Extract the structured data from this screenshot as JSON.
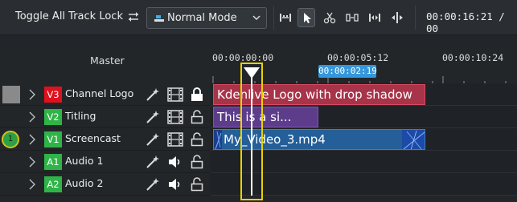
{
  "toolbar": {
    "toggle_lock_label": "Toggle All Track Lock",
    "mode_label": "Normal Mode",
    "timecode": "00:00:16:21 / 00",
    "tools": [
      "spacer-tool-icon",
      "selection-tool-icon",
      "razor-tool-icon",
      "slip-tool-icon",
      "ripple-tool-icon",
      "multicam-tool-icon"
    ]
  },
  "header": {
    "master_label": "Master"
  },
  "ruler": {
    "labels": [
      "00:00:00:00",
      "00:00:05:12",
      "00:00:10:24"
    ],
    "zone_label": "00:00:02:19"
  },
  "tracks": [
    {
      "tag": "V3",
      "name": "Channel Logo",
      "tag_color": "#e0111d",
      "tag_text_color": "#ffffff",
      "locked": true
    },
    {
      "tag": "V2",
      "name": "Titling",
      "tag_color": "#2fb547",
      "tag_text_color": "#ffffff",
      "locked": false
    },
    {
      "tag": "V1",
      "name": "Screencast",
      "tag_color": "#2fb547",
      "tag_text_color": "#ffffff",
      "locked": false,
      "target_label": "1"
    },
    {
      "tag": "A1",
      "name": "Audio 1",
      "tag_color": "#2fb547",
      "tag_text_color": "#ffffff",
      "locked": false
    },
    {
      "tag": "A2",
      "name": "Audio 2",
      "tag_color": "#2fb547",
      "tag_text_color": "#ffffff",
      "locked": false
    }
  ],
  "clips": [
    {
      "text": "Kdenlive Logo with drop shadow",
      "color": "#a8344a"
    },
    {
      "text": "This is a si...",
      "color": "#5d3c8c"
    },
    {
      "text": "My_Video_3.mp4",
      "color": "#245f9a"
    }
  ],
  "colors": {
    "playhead_box": "#e8d200",
    "zone": "#3597dc",
    "background": "#232629"
  }
}
